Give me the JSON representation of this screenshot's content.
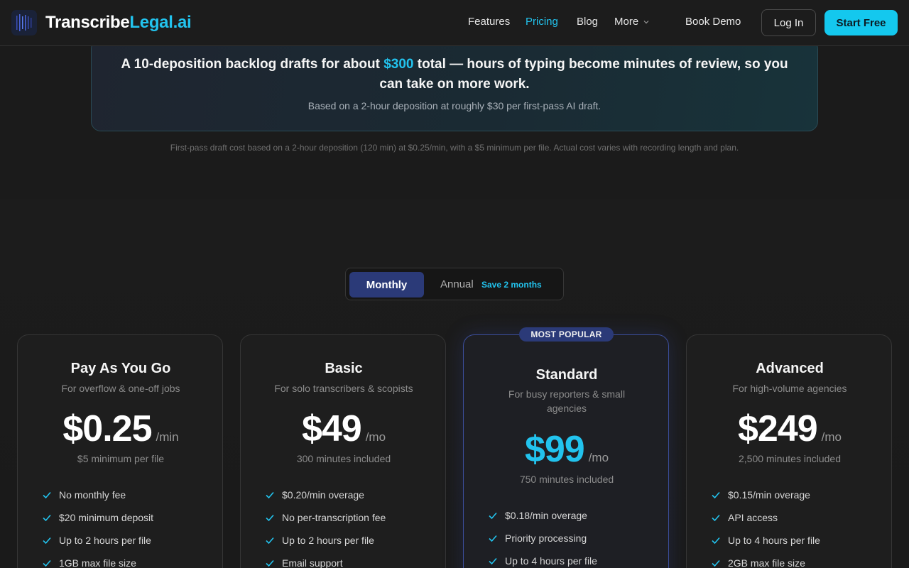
{
  "nav": {
    "brand_a": "Transcribe",
    "brand_b": "Legal.ai",
    "links": [
      "Features",
      "Pricing",
      "Blog"
    ],
    "more": "More",
    "book_demo": "Book Demo",
    "login": "Log In",
    "start": "Start Free"
  },
  "banner": {
    "head_pre": "A 10-deposition backlog drafts for about ",
    "head_amount": "$300",
    "head_post": " total — hours of typing become minutes of review, so you can take on more work.",
    "sub": "Based on a 2-hour deposition at roughly $30 per first-pass AI draft."
  },
  "disclaimer": "First-pass draft cost based on a 2-hour deposition (120 min) at $0.25/min, with a $5 minimum per file. Actual cost varies with recording length and plan.",
  "toggle": {
    "monthly": "Monthly",
    "annual": "Annual",
    "save": "Save 2 months"
  },
  "badge": "MOST POPULAR",
  "plans": [
    {
      "name": "Pay As You Go",
      "desc": "For overflow & one-off jobs",
      "price": "$0.25",
      "unit": "/min",
      "note": "$5 minimum per file",
      "features": [
        "No monthly fee",
        "$20 minimum deposit",
        "Up to 2 hours per file",
        "1GB max file size"
      ]
    },
    {
      "name": "Basic",
      "desc": "For solo transcribers & scopists",
      "price": "$49",
      "unit": "/mo",
      "note": "300 minutes included",
      "features": [
        "$0.20/min overage",
        "No per-transcription fee",
        "Up to 2 hours per file",
        "Email support"
      ]
    },
    {
      "name": "Standard",
      "desc": "For busy reporters & small agencies",
      "price": "$99",
      "unit": "/mo",
      "note": "750 minutes included",
      "features": [
        "$0.18/min overage",
        "Priority processing",
        "Up to 4 hours per file"
      ]
    },
    {
      "name": "Advanced",
      "desc": "For high-volume agencies",
      "price": "$249",
      "unit": "/mo",
      "note": "2,500 minutes included",
      "features": [
        "$0.15/min overage",
        "API access",
        "Up to 4 hours per file",
        "2GB max file size"
      ]
    }
  ],
  "colors": {
    "accent": "#22c3ee",
    "start_button": "#14c8ee",
    "toggle_active": "#2b3a78",
    "check": "#22c3ee"
  }
}
